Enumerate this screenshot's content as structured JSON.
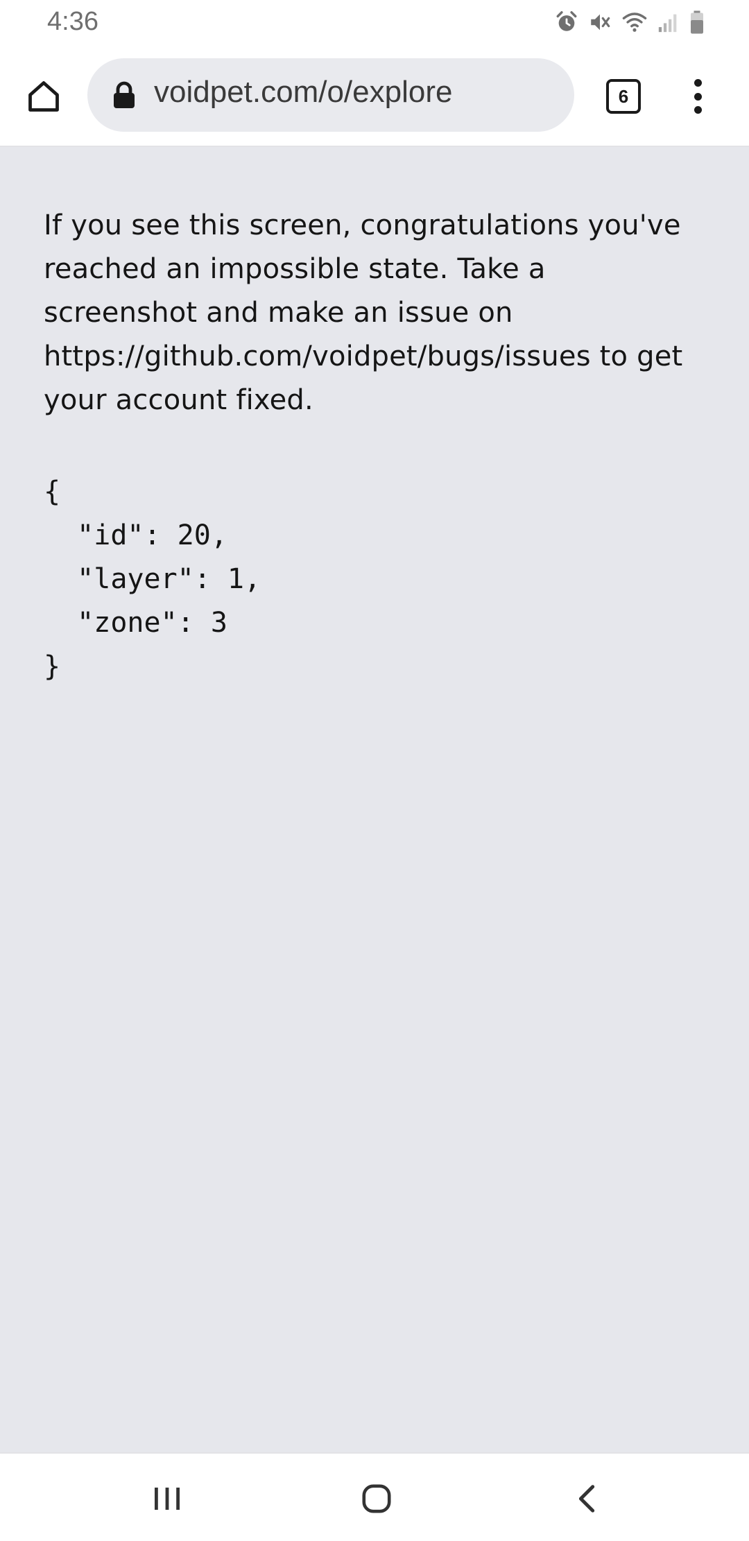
{
  "status_bar": {
    "time": "4:36",
    "icons": [
      "alarm-icon",
      "mute-icon",
      "wifi-icon",
      "signal-icon",
      "battery-icon"
    ]
  },
  "browser": {
    "url": "voidpet.com/o/explore",
    "tab_count": "6",
    "icons": [
      "home-icon",
      "lock-icon",
      "tabs-icon",
      "more-vert-icon"
    ]
  },
  "page": {
    "message": "If you see this screen, congratulations you've reached an impossible state. Take a screenshot and make an issue on https://github.com/voidpet/bugs/issues to get your account fixed.",
    "json_dump": "{\n  \"id\": 20,\n  \"layer\": 1,\n  \"zone\": 3\n}"
  },
  "nav_bar": {
    "icons": [
      "recents-icon",
      "home-circle-icon",
      "back-icon"
    ]
  },
  "colors": {
    "content_bg": "#e6e7ec",
    "urlbar_bg": "#e9eaee",
    "text": "#151515"
  }
}
